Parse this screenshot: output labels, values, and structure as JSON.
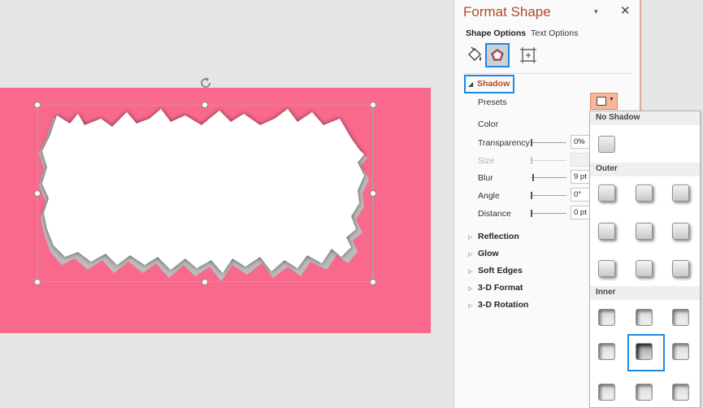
{
  "pane": {
    "title": "Format Shape",
    "dropdown_glyph": "▾",
    "close_glyph": "✕",
    "tabs": {
      "shape_options": "Shape Options",
      "text_options": "Text Options"
    },
    "category_icons": [
      "fill-line-icon",
      "effects-pentagon-icon",
      "size-properties-icon"
    ]
  },
  "shadow": {
    "header": "Shadow",
    "expanded_glyph": "◢",
    "props": {
      "presets": "Presets",
      "color": "Color",
      "transparency": {
        "label": "Transparency",
        "value": "0%",
        "level": 0
      },
      "size": {
        "label": "Size",
        "value": "",
        "disabled": true
      },
      "blur": {
        "label": "Blur",
        "value": "9 pt",
        "level": 0.05
      },
      "angle": {
        "label": "Angle",
        "value": "0°",
        "level": 0
      },
      "distance": {
        "label": "Distance",
        "value": "0 pt",
        "level": 0
      }
    }
  },
  "sections": [
    {
      "label": "Reflection",
      "glyph": "▷"
    },
    {
      "label": "Glow",
      "glyph": "▷"
    },
    {
      "label": "Soft Edges",
      "glyph": "▷"
    },
    {
      "label": "3-D Format",
      "glyph": "▷"
    },
    {
      "label": "3-D Rotation",
      "glyph": "▷"
    }
  ],
  "gallery": {
    "groups": [
      {
        "label": "No Shadow",
        "count": 1,
        "style": "none"
      },
      {
        "label": "Outer",
        "count": 9,
        "style": "outer"
      },
      {
        "label": "Inner",
        "count": 9,
        "style": "inner"
      }
    ],
    "selected": {
      "group": "Inner",
      "index": 4
    }
  },
  "colors": {
    "slide_fill": "#f8698c",
    "pane_accent": "#b7472a",
    "selection_blue": "#1e88e5",
    "presets_button": "#f6b79b"
  }
}
